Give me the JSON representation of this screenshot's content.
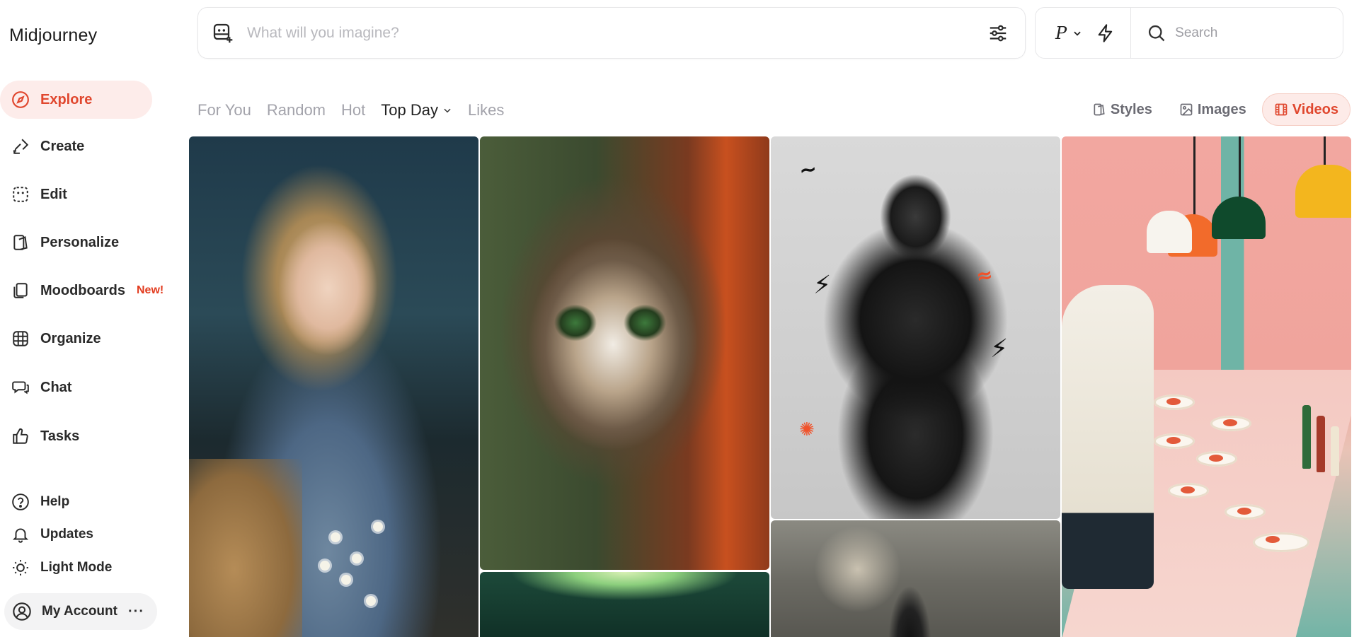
{
  "app": {
    "brand": "Midjourney"
  },
  "sidebar": {
    "nav": [
      {
        "id": "explore",
        "label": "Explore",
        "icon": "compass-icon",
        "active": true
      },
      {
        "id": "create",
        "label": "Create",
        "icon": "brush-icon"
      },
      {
        "id": "edit",
        "label": "Edit",
        "icon": "edit-frame-icon"
      },
      {
        "id": "personalize",
        "label": "Personalize",
        "icon": "personalize-icon"
      },
      {
        "id": "moodboards",
        "label": "Moodboards",
        "icon": "moodboards-icon",
        "badge": "New!"
      },
      {
        "id": "organize",
        "label": "Organize",
        "icon": "grid-icon"
      },
      {
        "id": "chat",
        "label": "Chat",
        "icon": "chat-icon"
      },
      {
        "id": "tasks",
        "label": "Tasks",
        "icon": "thumbs-up-icon"
      }
    ],
    "secondary": [
      {
        "id": "help",
        "label": "Help",
        "icon": "help-icon"
      },
      {
        "id": "updates",
        "label": "Updates",
        "icon": "bell-icon"
      },
      {
        "id": "light-mode",
        "label": "Light Mode",
        "icon": "sun-icon"
      }
    ],
    "account": {
      "label": "My Account",
      "more": "···"
    }
  },
  "topbar": {
    "prompt_placeholder": "What will you imagine?",
    "personalize_letter": "P",
    "search_placeholder": "Search"
  },
  "filters": {
    "tabs": [
      {
        "label": "For You",
        "active": false
      },
      {
        "label": "Random",
        "active": false
      },
      {
        "label": "Hot",
        "active": false
      },
      {
        "label": "Top Day",
        "active": true,
        "dropdown": true
      },
      {
        "label": "Likes",
        "active": false
      }
    ],
    "views": [
      {
        "label": "Styles",
        "icon": "styles-icon",
        "active": false
      },
      {
        "label": "Images",
        "icon": "image-icon",
        "active": false
      },
      {
        "label": "Videos",
        "icon": "film-icon",
        "active": true
      }
    ]
  },
  "colors": {
    "accent": "#e0472e",
    "accent_bg": "#fdecea",
    "badge": "#e23b1e"
  }
}
